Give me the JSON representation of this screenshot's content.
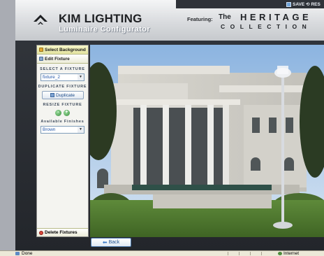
{
  "header": {
    "save_label": "SAVE",
    "reset_label": "RES",
    "brand": "KIM LIGHTING",
    "subtitle": "Luminaire Configurator",
    "featuring_label": "Featuring:",
    "collection_the": "The",
    "collection_name": "HERITAGE",
    "collection_word": "COLLECTION"
  },
  "panel": {
    "tab_background": "Select Background",
    "tab_fixture": "Edit Fixture",
    "select_fixture_label": "SELECT A FIXTURE",
    "selected_fixture": "fixture_2",
    "duplicate_section_label": "DUPLICATE FIXTURE",
    "duplicate_button": "Duplicate",
    "resize_label": "RESIZE FIXTURE",
    "resize_minus": "-",
    "resize_plus": "+",
    "finishes_label": "Available Finishes",
    "selected_finish": "Brown",
    "delete_label": "Delete Fixtures"
  },
  "back_button": "Back",
  "statusbar": {
    "status_text": "Done",
    "zone_label": "Internet"
  },
  "colors": {
    "accent_blue": "#2356a8",
    "panel_tab_yellow": "#e3e3a0",
    "header_dark": "#2e3238"
  }
}
